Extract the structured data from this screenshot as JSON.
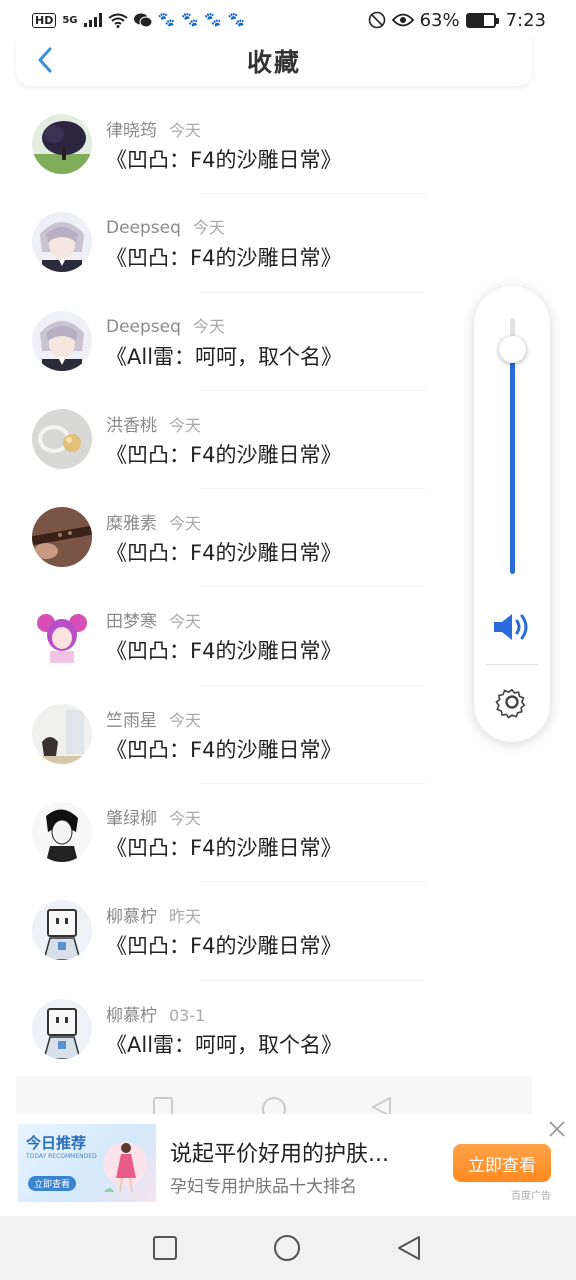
{
  "status_bar": {
    "hd": "HD",
    "network": "5G",
    "battery_percent": "63%",
    "battery_level": 0.63,
    "time": "7:23"
  },
  "header": {
    "title": "收藏",
    "back_icon": "chevron-left-icon"
  },
  "favorites": [
    {
      "user": "律晓筠",
      "time": "今天",
      "title": "《凹凸：F4的沙雕日常》",
      "avatar": "tree"
    },
    {
      "user": "Deepseq",
      "time": "今天",
      "title": "《凹凸：F4的沙雕日常》",
      "avatar": "anime-boy"
    },
    {
      "user": "Deepseq",
      "time": "今天",
      "title": "《All雷：呵呵，取个名》",
      "avatar": "anime-boy"
    },
    {
      "user": "洪香桃",
      "time": "今天",
      "title": "《凹凸：F4的沙雕日常》",
      "avatar": "jewelry"
    },
    {
      "user": "糜雅素",
      "time": "今天",
      "title": "《凹凸：F4的沙雕日常》",
      "avatar": "flute"
    },
    {
      "user": "田梦寒",
      "time": "今天",
      "title": "《凹凸：F4的沙雕日常》",
      "avatar": "anime-girl"
    },
    {
      "user": "竺雨星",
      "time": "今天",
      "title": "《凹凸：F4的沙雕日常》",
      "avatar": "room"
    },
    {
      "user": "肇绿柳",
      "time": "今天",
      "title": "《凹凸：F4的沙雕日常》",
      "avatar": "sketch"
    },
    {
      "user": "柳慕柠",
      "time": "昨天",
      "title": "《凹凸：F4的沙雕日常》",
      "avatar": "robot"
    },
    {
      "user": "柳慕柠",
      "time": "03-1",
      "title": "《All雷：呵呵，取个名》",
      "avatar": "robot"
    }
  ],
  "volume": {
    "level": 0.88,
    "speaker_icon": "speaker-icon",
    "settings_icon": "gear-icon"
  },
  "ad": {
    "image_title": "今日推荐",
    "image_subtitle": "TODAY RECOMMENDED",
    "image_button": "立即查看",
    "title": "说起平价好用的护肤...",
    "subtitle": "孕妇专用护肤品十大排名",
    "cta": "立即查看",
    "source": "百度广告"
  },
  "nav": {
    "recents_icon": "square-icon",
    "home_icon": "circle-icon",
    "back_icon": "triangle-back-icon"
  },
  "colors": {
    "accent": "#2c6bdb",
    "back_arrow": "#3a8fd8",
    "cta": "#ff8a1f"
  }
}
